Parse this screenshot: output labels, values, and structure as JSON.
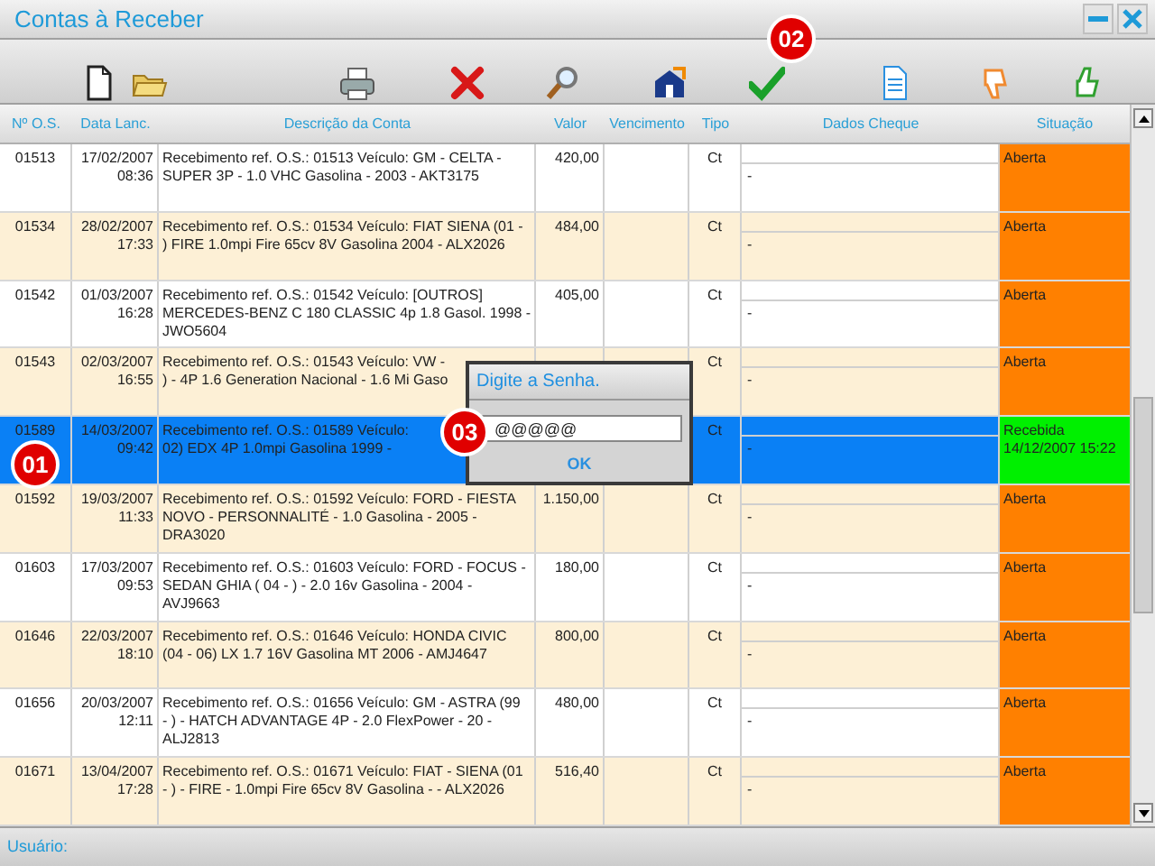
{
  "window": {
    "title": "Contas à Receber"
  },
  "toolbar": {
    "badge": "02"
  },
  "columns": [
    "Nº O.S.",
    "Data Lanc.",
    "Descrição da Conta",
    "Valor",
    "Vencimento",
    "Tipo",
    "Dados Cheque",
    "Situação"
  ],
  "rows": [
    {
      "os": "01513",
      "date": "17/02/2007",
      "time": "08:36",
      "description": [
        "Recebimento ref. O.S.: 01513 Veículo: GM - CELTA -",
        "SUPER 3P - 1.0 VHC Gasolina - 2003 - AKT3175"
      ],
      "value": "420,00",
      "tipo": "Ct",
      "cheque": "-",
      "status": {
        "kind": "open",
        "text": "Aberta"
      },
      "selected": false
    },
    {
      "os": "01534",
      "date": "28/02/2007",
      "time": "17:33",
      "description": [
        "Recebimento ref. O.S.: 01534 Veículo: FIAT SIENA (01 -",
        ") FIRE 1.0mpi Fire 65cv 8V Gasolina 2004 - ALX2026"
      ],
      "value": "484,00",
      "tipo": "Ct",
      "cheque": "-",
      "status": {
        "kind": "open",
        "text": "Aberta"
      },
      "selected": false
    },
    {
      "os": "01542",
      "date": "01/03/2007",
      "time": "16:28",
      "description": [
        "Recebimento ref. O.S.: 01542 Veículo: [OUTROS]",
        "MERCEDES-BENZ C 180 CLASSIC 4p 1.8 Gasol. 1998 -",
        "JWO5604"
      ],
      "value": "405,00",
      "tipo": "Ct",
      "cheque": "-",
      "status": {
        "kind": "open",
        "text": "Aberta"
      },
      "selected": false
    },
    {
      "os": "01543",
      "date": "02/03/2007",
      "time": "16:55",
      "description": [
        "Recebimento ref. O.S.: 01543 Veículo: VW -",
        ") - 4P 1.6 Generation Nacional - 1.6 Mi Gaso"
      ],
      "tipo": "Ct",
      "cheque": "-",
      "status": {
        "kind": "open",
        "text": "Aberta"
      },
      "selected": false
    },
    {
      "os": "01589",
      "date": "14/03/2007",
      "time": "09:42",
      "description": [
        "Recebimento ref. O.S.: 01589 Veículo:",
        "02) EDX 4P 1.0mpi Gasolina 1999 -"
      ],
      "tipo": "Ct",
      "cheque": "-",
      "status": {
        "kind": "received",
        "text": "Recebida",
        "date": "14/12/2007 15:22"
      },
      "selected": true,
      "badge": "01"
    },
    {
      "os": "01592",
      "date": "19/03/2007",
      "time": "11:33",
      "description": [
        "Recebimento ref. O.S.: 01592 Veículo: FORD - FIESTA",
        "NOVO - PERSONNALITÉ - 1.0 Gasolina - 2005 -",
        "DRA3020"
      ],
      "value": "1.150,00",
      "tipo": "Ct",
      "cheque": "-",
      "status": {
        "kind": "open",
        "text": "Aberta"
      },
      "selected": false
    },
    {
      "os": "01603",
      "date": "17/03/2007",
      "time": "09:53",
      "description": [
        "Recebimento ref. O.S.: 01603 Veículo: FORD - FOCUS -",
        "SEDAN GHIA ( 04 - ) - 2.0 16v Gasolina - 2004 -",
        "AVJ9663"
      ],
      "value": "180,00",
      "tipo": "Ct",
      "cheque": "-",
      "status": {
        "kind": "open",
        "text": "Aberta"
      },
      "selected": false
    },
    {
      "os": "01646",
      "date": "22/03/2007",
      "time": "18:10",
      "description": [
        "Recebimento ref. O.S.: 01646 Veículo: HONDA CIVIC",
        "(04 - 06) LX 1.7 16V Gasolina MT 2006 - AMJ4647"
      ],
      "value": "800,00",
      "tipo": "Ct",
      "cheque": "-",
      "status": {
        "kind": "open",
        "text": "Aberta"
      },
      "selected": false
    },
    {
      "os": "01656",
      "date": "20/03/2007",
      "time": "12:11",
      "description": [
        "Recebimento ref. O.S.: 01656 Veículo: GM - ASTRA (99",
        "- ) - HATCH ADVANTAGE 4P - 2.0 FlexPower - 20 -",
        "ALJ2813"
      ],
      "value": "480,00",
      "tipo": "Ct",
      "cheque": "-",
      "status": {
        "kind": "open",
        "text": "Aberta"
      },
      "selected": false
    },
    {
      "os": "01671",
      "date": "13/04/2007",
      "time": "17:28",
      "description": [
        "Recebimento ref. O.S.: 01671 Veículo: FIAT - SIENA (01",
        "- ) - FIRE - 1.0mpi Fire 65cv 8V Gasolina - - ALX2026"
      ],
      "value": "516,40",
      "tipo": "Ct",
      "cheque": "-",
      "status": {
        "kind": "open",
        "text": "Aberta"
      },
      "selected": false
    }
  ],
  "dialog": {
    "title": "Digite a Senha.",
    "value": "@@@@@",
    "button": "OK",
    "badge": "03"
  },
  "status_bar": {
    "label": "Usuário:"
  }
}
